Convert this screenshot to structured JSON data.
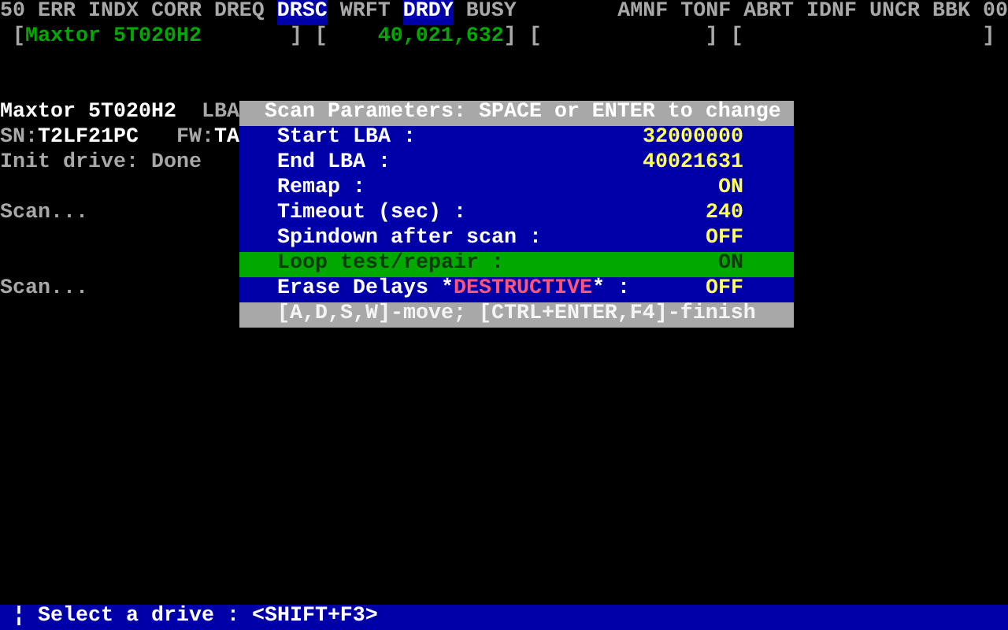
{
  "flags_left": [
    {
      "label": "50",
      "on": false
    },
    {
      "label": "ERR",
      "on": false
    },
    {
      "label": "INDX",
      "on": false
    },
    {
      "label": "CORR",
      "on": false
    },
    {
      "label": "DREQ",
      "on": false
    },
    {
      "label": "DRSC",
      "on": true
    },
    {
      "label": "WRFT",
      "on": false
    },
    {
      "label": "DRDY",
      "on": true
    },
    {
      "label": "BUSY",
      "on": false
    }
  ],
  "flags_right": [
    {
      "label": "AMNF",
      "on": false
    },
    {
      "label": "TONF",
      "on": false
    },
    {
      "label": "ABRT",
      "on": false
    },
    {
      "label": "IDNF",
      "on": false
    },
    {
      "label": "UNCR",
      "on": false
    },
    {
      "label": "BBK",
      "on": false
    },
    {
      "label": "00",
      "on": false
    }
  ],
  "drive_fields": [
    {
      "kind": "model",
      "open": "[",
      "value": "Maxtor 5T020H2",
      "close": "]"
    },
    {
      "kind": "capacity",
      "open": "[",
      "value": "40,021,632",
      "close": "]"
    },
    {
      "kind": "empty",
      "open": "[",
      "close": "]"
    },
    {
      "kind": "empty",
      "open": "[",
      "close": "]"
    }
  ],
  "log": [
    [
      {
        "kind": "value",
        "text": "Maxtor 5T020H2"
      },
      {
        "kind": "label",
        "text": "LBA"
      }
    ],
    [
      {
        "kind": "pair",
        "label": "SN:",
        "text": "T2LF21PC"
      },
      {
        "kind": "pair",
        "label": "FW:",
        "text": "TA"
      }
    ],
    [
      {
        "kind": "label",
        "text": "Init drive: Done"
      }
    ],
    [
      {
        "kind": "label",
        "text": "Scan..."
      }
    ],
    [
      {
        "kind": "label",
        "text": "Scan..."
      }
    ]
  ],
  "dialog": {
    "title": "Scan Parameters: SPACE or ENTER to change",
    "items": [
      {
        "label": "Start LBA :",
        "value": "32000000",
        "selected": false
      },
      {
        "label": "End LBA :",
        "value": "40021631",
        "selected": false
      },
      {
        "label": "Remap :",
        "value": "ON",
        "selected": false
      },
      {
        "label": "Timeout (sec) :",
        "value": "240",
        "selected": false
      },
      {
        "label": "Spindown after scan :",
        "value": "OFF",
        "selected": false
      },
      {
        "label": "Loop test/repair :",
        "value": "ON",
        "selected": true
      },
      {
        "label": "Erase Delays *",
        "warning": "DESTRUCTIVE",
        "label_end": "* :",
        "value": "OFF",
        "selected": false
      }
    ],
    "footer": "[A,D,S,W]-move; [CTRL+ENTER,F4]-finish"
  },
  "status_bar": "¦ Select a drive : <SHIFT+F3>"
}
